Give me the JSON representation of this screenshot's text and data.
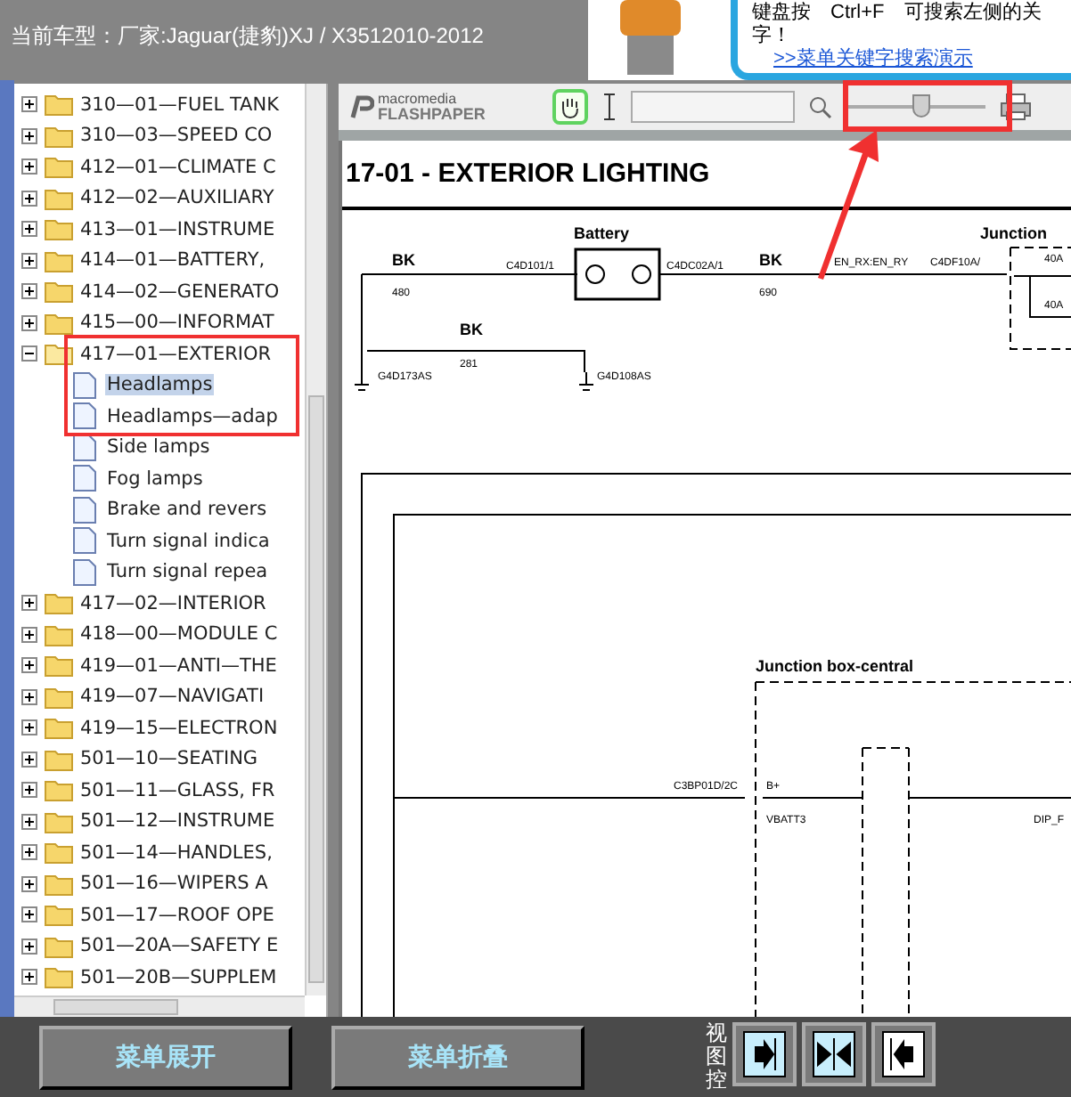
{
  "header": {
    "title": "当前车型：厂家:Jaguar(捷豹)XJ / X3512010-2012",
    "help_lines": [
      "键盘按　Ctrl+F　可搜索左侧的关",
      "字！"
    ],
    "help_link": ">>菜单关键字搜索演示"
  },
  "tree": [
    {
      "label": "310—01—FUEL TANK",
      "kind": "folder",
      "expanded": false
    },
    {
      "label": "310—03—SPEED CO",
      "kind": "folder",
      "expanded": false
    },
    {
      "label": "412—01—CLIMATE C",
      "kind": "folder",
      "expanded": false
    },
    {
      "label": "412—02—AUXILIARY",
      "kind": "folder",
      "expanded": false
    },
    {
      "label": "413—01—INSTRUME",
      "kind": "folder",
      "expanded": false
    },
    {
      "label": "414—01—BATTERY,",
      "kind": "folder",
      "expanded": false
    },
    {
      "label": "414—02—GENERATO",
      "kind": "folder",
      "expanded": false
    },
    {
      "label": "415—00—INFORMAT",
      "kind": "folder",
      "expanded": false
    },
    {
      "label": "417—01—EXTERIOR",
      "kind": "folder",
      "expanded": true,
      "children": [
        {
          "label": "Headlamps",
          "kind": "page",
          "selected": true
        },
        {
          "label": "Headlamps—adap",
          "kind": "page",
          "selected": false
        },
        {
          "label": "Side lamps",
          "kind": "page",
          "selected": false
        },
        {
          "label": "Fog lamps",
          "kind": "page",
          "selected": false
        },
        {
          "label": "Brake and revers",
          "kind": "page",
          "selected": false
        },
        {
          "label": "Turn signal indica",
          "kind": "page",
          "selected": false
        },
        {
          "label": "Turn signal repea",
          "kind": "page",
          "selected": false
        }
      ]
    },
    {
      "label": "417—02—INTERIOR",
      "kind": "folder",
      "expanded": false
    },
    {
      "label": "418—00—MODULE C",
      "kind": "folder",
      "expanded": false
    },
    {
      "label": "419—01—ANTI—THE",
      "kind": "folder",
      "expanded": false
    },
    {
      "label": "419—07—NAVIGATI",
      "kind": "folder",
      "expanded": false
    },
    {
      "label": "419—15—ELECTRON",
      "kind": "folder",
      "expanded": false
    },
    {
      "label": "501—10—SEATING",
      "kind": "folder",
      "expanded": false
    },
    {
      "label": "501—11—GLASS, FR",
      "kind": "folder",
      "expanded": false
    },
    {
      "label": "501—12—INSTRUME",
      "kind": "folder",
      "expanded": false
    },
    {
      "label": "501—14—HANDLES,",
      "kind": "folder",
      "expanded": false
    },
    {
      "label": "501—16—WIPERS A",
      "kind": "folder",
      "expanded": false
    },
    {
      "label": "501—17—ROOF OPE",
      "kind": "folder",
      "expanded": false
    },
    {
      "label": "501—20A—SAFETY E",
      "kind": "folder",
      "expanded": false
    },
    {
      "label": "501—20B—SUPPLEM",
      "kind": "folder",
      "expanded": false
    }
  ],
  "viewer": {
    "logo_top": "macromedia",
    "logo_bottom": "FLASHPAPER",
    "hand_tool_selected": true,
    "zoom": {
      "level": 0.55
    },
    "page_title": "17-01 - EXTERIOR LIGHTING",
    "diagram_labels": [
      "Battery",
      "BK",
      "480",
      "C4D101/1",
      "C4DC02A/1",
      "BK",
      "690",
      "EN_RX:EN_RY",
      "C4DF10A/",
      "Junction",
      "40A",
      "40A",
      "BK",
      "281",
      "G4D173AS",
      "G4D108AS",
      "Junction box-central",
      "C3BP01D/2C",
      "B+",
      "VBATT3",
      "DIP_F"
    ]
  },
  "buttons": [
    "菜单展开",
    "菜单折叠"
  ],
  "view_control_label": "视图控"
}
